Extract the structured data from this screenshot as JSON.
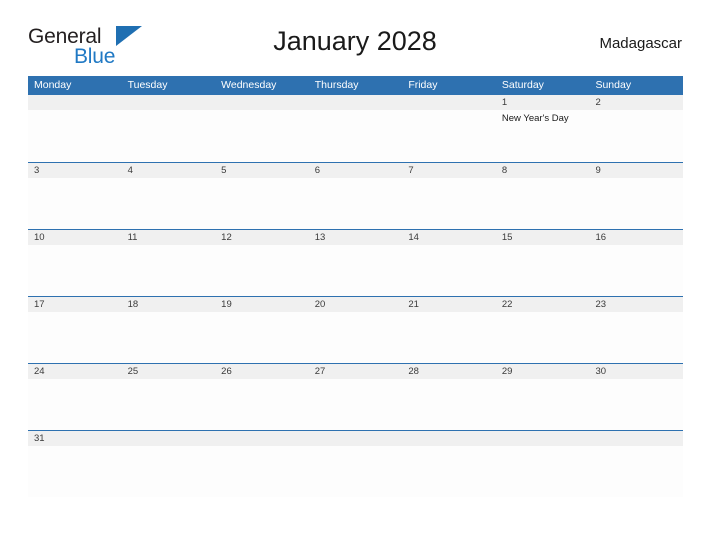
{
  "brand": {
    "word_one": "General",
    "word_two": "Blue",
    "flag_icon": "blue-flag-triangle",
    "color_dark": "#231f20",
    "color_blue": "#2079c4"
  },
  "header": {
    "title": "January 2028",
    "country": "Madagascar"
  },
  "theme": {
    "header_blue": "#2e71b0",
    "number_band_gray": "#f0f0f0",
    "rule_blue": "#2e71b0",
    "body_white": "#fdfdfd",
    "text_dark": "#1a1a1a"
  },
  "calendar": {
    "weekdays": [
      "Monday",
      "Tuesday",
      "Wednesday",
      "Thursday",
      "Friday",
      "Saturday",
      "Sunday"
    ],
    "weeks": [
      {
        "days": [
          "",
          "",
          "",
          "",
          "",
          "1",
          "2"
        ],
        "events": [
          "",
          "",
          "",
          "",
          "",
          "New Year's Day",
          ""
        ]
      },
      {
        "days": [
          "3",
          "4",
          "5",
          "6",
          "7",
          "8",
          "9"
        ],
        "events": [
          "",
          "",
          "",
          "",
          "",
          "",
          ""
        ]
      },
      {
        "days": [
          "10",
          "11",
          "12",
          "13",
          "14",
          "15",
          "16"
        ],
        "events": [
          "",
          "",
          "",
          "",
          "",
          "",
          ""
        ]
      },
      {
        "days": [
          "17",
          "18",
          "19",
          "20",
          "21",
          "22",
          "23"
        ],
        "events": [
          "",
          "",
          "",
          "",
          "",
          "",
          ""
        ]
      },
      {
        "days": [
          "24",
          "25",
          "26",
          "27",
          "28",
          "29",
          "30"
        ],
        "events": [
          "",
          "",
          "",
          "",
          "",
          "",
          ""
        ]
      },
      {
        "days": [
          "31",
          "",
          "",
          "",
          "",
          "",
          ""
        ],
        "events": [
          "",
          "",
          "",
          "",
          "",
          "",
          ""
        ]
      }
    ]
  }
}
